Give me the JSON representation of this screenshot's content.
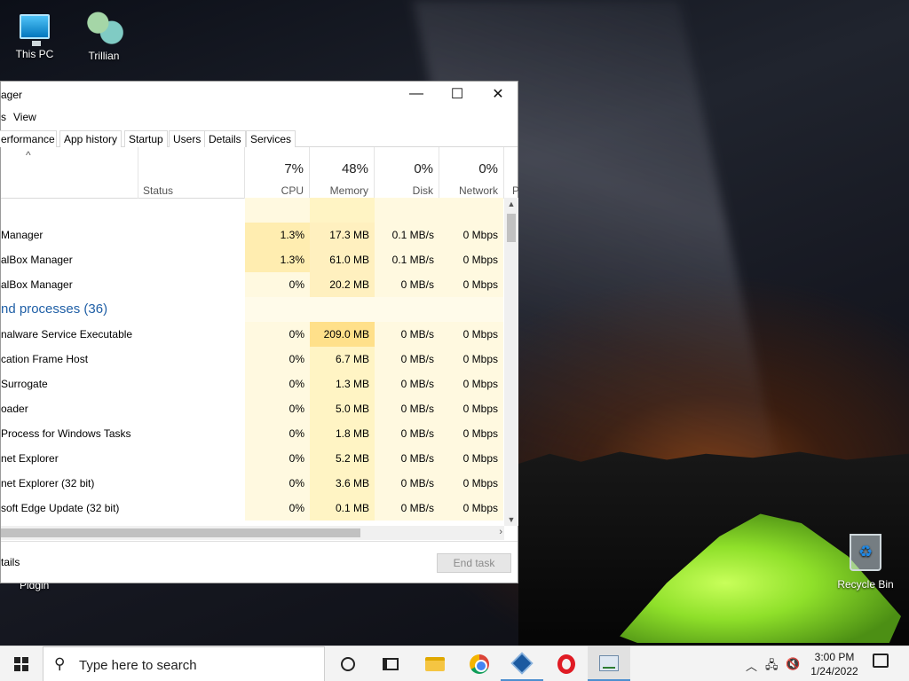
{
  "desktop": {
    "icons": [
      {
        "label": "This PC"
      },
      {
        "label": "Trillian"
      },
      {
        "label": "Recycle Bin"
      }
    ],
    "partial_label": "Pidgin"
  },
  "window": {
    "title": "ager",
    "controls": {
      "minimize": "—",
      "maximize": "☐",
      "close": "✕"
    },
    "menu": [
      "s",
      "View"
    ],
    "tabs": [
      "erformance",
      "App history",
      "Startup",
      "Users",
      "Details",
      "Services"
    ],
    "active_tab": "erformance",
    "columns": {
      "status": "Status",
      "cpu": {
        "pct": "7%",
        "label": "CPU"
      },
      "memory": {
        "pct": "48%",
        "label": "Memory"
      },
      "disk": {
        "pct": "0%",
        "label": "Disk"
      },
      "network": {
        "pct": "0%",
        "label": "Network"
      },
      "power_partial": "P"
    },
    "rows": [
      {
        "name": "",
        "cpu": "",
        "mem": "",
        "disk": "",
        "net": "",
        "type": "blank"
      },
      {
        "name": "Manager",
        "cpu": "1.3%",
        "mem": "17.3 MB",
        "disk": "0.1 MB/s",
        "net": "0 Mbps"
      },
      {
        "name": "alBox Manager",
        "cpu": "1.3%",
        "mem": "61.0 MB",
        "disk": "0.1 MB/s",
        "net": "0 Mbps"
      },
      {
        "name": "alBox Manager",
        "cpu": "0%",
        "mem": "20.2 MB",
        "disk": "0 MB/s",
        "net": "0 Mbps"
      },
      {
        "name": "nd processes (36)",
        "cpu": "",
        "mem": "",
        "disk": "",
        "net": "",
        "type": "group"
      },
      {
        "name": "nalware Service Executable",
        "cpu": "0%",
        "mem": "209.0 MB",
        "disk": "0 MB/s",
        "net": "0 Mbps"
      },
      {
        "name": "cation Frame Host",
        "cpu": "0%",
        "mem": "6.7 MB",
        "disk": "0 MB/s",
        "net": "0 Mbps"
      },
      {
        "name": " Surrogate",
        "cpu": "0%",
        "mem": "1.3 MB",
        "disk": "0 MB/s",
        "net": "0 Mbps"
      },
      {
        "name": "oader",
        "cpu": "0%",
        "mem": "5.0 MB",
        "disk": "0 MB/s",
        "net": "0 Mbps"
      },
      {
        "name": " Process for Windows Tasks",
        "cpu": "0%",
        "mem": "1.8 MB",
        "disk": "0 MB/s",
        "net": "0 Mbps"
      },
      {
        "name": "net Explorer",
        "cpu": "0%",
        "mem": "5.2 MB",
        "disk": "0 MB/s",
        "net": "0 Mbps"
      },
      {
        "name": "net Explorer (32 bit)",
        "cpu": "0%",
        "mem": "3.6 MB",
        "disk": "0 MB/s",
        "net": "0 Mbps"
      },
      {
        "name": "soft Edge Update (32 bit)",
        "cpu": "0%",
        "mem": "0.1 MB",
        "disk": "0 MB/s",
        "net": "0 Mbps"
      }
    ],
    "footer": {
      "details": "tails",
      "end_task": "End task"
    }
  },
  "taskbar": {
    "search_placeholder": "Type here to search",
    "apps": [
      "cortana-icon",
      "task-view-icon",
      "file-explorer-icon",
      "chrome-icon",
      "virtualbox-icon",
      "opera-icon",
      "task-manager-icon"
    ],
    "clock": {
      "time": "3:00 PM",
      "date": "1/24/2022"
    }
  },
  "colors": {
    "cpu_heat": "#fff4c4",
    "mem_heat_high": "#ffe08a",
    "group_text": "#1f5fa6",
    "taskbar_accent": "#4d8fcf"
  }
}
